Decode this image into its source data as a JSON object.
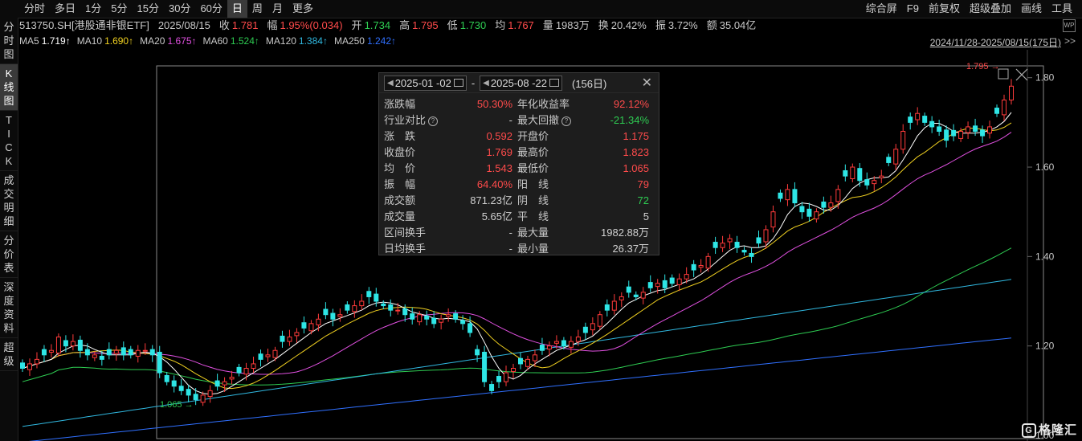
{
  "toolbar": {
    "periods": [
      "分时",
      "多日",
      "1分",
      "5分",
      "15分",
      "30分",
      "60分",
      "日",
      "周",
      "月",
      "更多"
    ],
    "active_period": "日",
    "right": [
      "综合屏",
      "F9",
      "前复权",
      "超级叠加",
      "画线",
      "工具"
    ]
  },
  "sidebar": [
    "分时图",
    "K线图",
    "TICK",
    "成交明细",
    "分价表",
    "深度资料",
    "超级"
  ],
  "sidebar_active": "K线图",
  "info": {
    "code": "513750.SH[港股通非银ETF]",
    "date": "2025/08/15",
    "close_label": "收",
    "close": "1.781",
    "chg_label": "幅",
    "chg": "1.95%(0.034)",
    "open_label": "开",
    "open": "1.734",
    "high_label": "高",
    "high": "1.795",
    "low_label": "低",
    "low": "1.730",
    "avg_label": "均",
    "avg": "1.767",
    "vol_label": "量",
    "vol": "1983万",
    "turn_label": "换",
    "turn": "20.42%",
    "amp_label": "振",
    "amp": "3.72%",
    "amt_label": "额",
    "amt": "35.04亿"
  },
  "ma": [
    {
      "label": "MA5",
      "value": "1.719↑",
      "color": "#ffffff"
    },
    {
      "label": "MA10",
      "value": "1.690↑",
      "color": "#f0d020"
    },
    {
      "label": "MA20",
      "value": "1.675↑",
      "color": "#e050e0"
    },
    {
      "label": "MA60",
      "value": "1.524↑",
      "color": "#2ecc52"
    },
    {
      "label": "MA120",
      "value": "1.384↑",
      "color": "#30b8e0"
    },
    {
      "label": "MA250",
      "value": "1.242↑",
      "color": "#3070ff"
    }
  ],
  "range_label": "2024/11/28-2025/08/15(175日)",
  "popup": {
    "start": "2025-01 -02",
    "end": "2025-08 -22",
    "days": "(156日)",
    "rows": [
      {
        "l1": "涨跌幅",
        "v1": "50.30%",
        "c1": "red",
        "l2": "年化收益率",
        "v2": "92.12%",
        "c2": "red"
      },
      {
        "l1": "行业对比",
        "q1": true,
        "v1": "-",
        "c1": "gray",
        "l2": "最大回撤",
        "q2": true,
        "v2": "-21.34%",
        "c2": "green"
      },
      {
        "l1": "涨　跌",
        "v1": "0.592",
        "c1": "red",
        "l2": "开盘价",
        "v2": "1.175",
        "c2": "red"
      },
      {
        "l1": "收盘价",
        "v1": "1.769",
        "c1": "red",
        "l2": "最高价",
        "v2": "1.823",
        "c2": "red"
      },
      {
        "l1": "均　价",
        "v1": "1.543",
        "c1": "red",
        "l2": "最低价",
        "v2": "1.065",
        "c2": "red"
      },
      {
        "l1": "振　幅",
        "v1": "64.40%",
        "c1": "red",
        "l2": "阳　线",
        "v2": "79",
        "c2": "red"
      },
      {
        "l1": "成交额",
        "v1": "871.23亿",
        "c1": "gray",
        "l2": "阴　线",
        "v2": "72",
        "c2": "green"
      },
      {
        "l1": "成交量",
        "v1": "5.65亿",
        "c1": "gray",
        "l2": "平　线",
        "v2": "5",
        "c2": "gray"
      },
      {
        "l1": "区间换手",
        "v1": "-",
        "c1": "gray",
        "l2": "最大量",
        "v2": "1982.88万",
        "c2": "gray"
      },
      {
        "l1": "日均换手",
        "v1": "-",
        "c1": "gray",
        "l2": "最小量",
        "v2": "26.37万",
        "c2": "gray"
      }
    ]
  },
  "logo": "格隆汇",
  "colors": {
    "up": "#ff3b3b",
    "down": "#2ee6e6",
    "ma5": "#ffffff",
    "ma10": "#f0d020",
    "ma20": "#e050e0",
    "ma60": "#2ecc52",
    "ma120": "#30b8e0",
    "ma250": "#3070ff"
  },
  "chart_data": {
    "type": "candlestick",
    "y_ticks": [
      "1.80",
      "1.60",
      "1.40",
      "1.20",
      "1.00"
    ],
    "ylim": [
      1.0,
      1.83
    ],
    "high_mark": "1.795",
    "low_mark": "1.065",
    "closes": [
      1.15,
      1.16,
      1.17,
      1.18,
      1.19,
      1.22,
      1.2,
      1.21,
      1.19,
      1.18,
      1.18,
      1.17,
      1.18,
      1.19,
      1.18,
      1.18,
      1.19,
      1.19,
      1.18,
      1.14,
      1.12,
      1.11,
      1.1,
      1.09,
      1.08,
      1.09,
      1.1,
      1.11,
      1.12,
      1.13,
      1.14,
      1.15,
      1.16,
      1.17,
      1.18,
      1.19,
      1.21,
      1.22,
      1.23,
      1.24,
      1.25,
      1.26,
      1.27,
      1.26,
      1.27,
      1.28,
      1.29,
      1.3,
      1.31,
      1.3,
      1.29,
      1.28,
      1.28,
      1.27,
      1.26,
      1.27,
      1.26,
      1.25,
      1.26,
      1.27,
      1.26,
      1.25,
      1.23,
      1.18,
      1.12,
      1.1,
      1.12,
      1.14,
      1.15,
      1.16,
      1.17,
      1.18,
      1.19,
      1.2,
      1.21,
      1.2,
      1.21,
      1.22,
      1.23,
      1.25,
      1.27,
      1.28,
      1.3,
      1.31,
      1.32,
      1.31,
      1.32,
      1.33,
      1.34,
      1.33,
      1.34,
      1.35,
      1.36,
      1.37,
      1.38,
      1.4,
      1.42,
      1.43,
      1.44,
      1.42,
      1.41,
      1.4,
      1.43,
      1.46,
      1.5,
      1.53,
      1.55,
      1.52,
      1.5,
      1.49,
      1.5,
      1.51,
      1.52,
      1.55,
      1.58,
      1.6,
      1.57,
      1.56,
      1.57,
      1.58,
      1.61,
      1.64,
      1.68,
      1.7,
      1.72,
      1.7,
      1.69,
      1.68,
      1.66,
      1.67,
      1.68,
      1.69,
      1.68,
      1.67,
      1.69,
      1.72,
      1.75,
      1.781
    ]
  }
}
